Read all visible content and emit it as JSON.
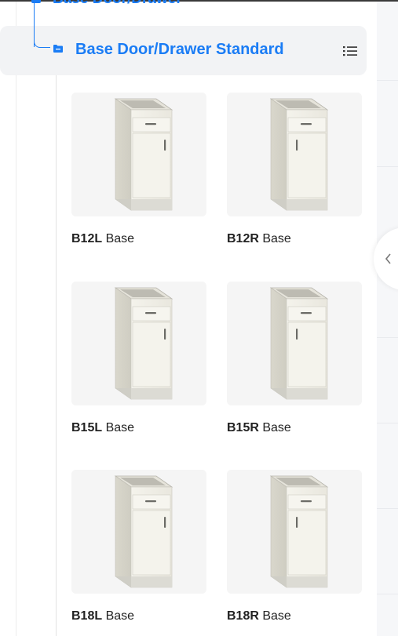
{
  "tree": {
    "parent_label": "Base Door/Drawer",
    "node_label": "Base Door/Drawer Standard",
    "accent_color": "#1a7cf5"
  },
  "items": [
    {
      "code": "B12L",
      "suffix": " Base",
      "hinge": "left"
    },
    {
      "code": "B12R",
      "suffix": " Base",
      "hinge": "right"
    },
    {
      "code": "B15L",
      "suffix": " Base",
      "hinge": "left"
    },
    {
      "code": "B15R",
      "suffix": " Base",
      "hinge": "right"
    },
    {
      "code": "B18L",
      "suffix": " Base",
      "hinge": "left"
    },
    {
      "code": "B18R",
      "suffix": " Base",
      "hinge": "right"
    }
  ],
  "icons": {
    "list_view": "list-view-icon",
    "collapse": "chevron-left-icon",
    "folder": "folder-icon"
  }
}
